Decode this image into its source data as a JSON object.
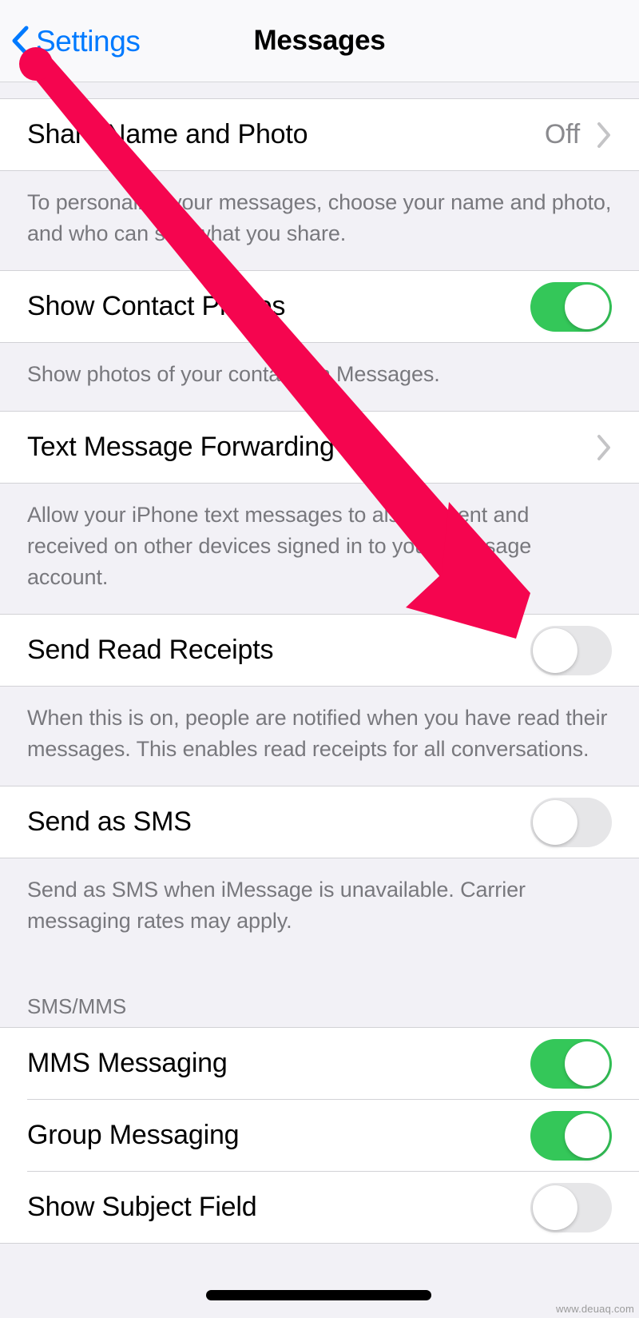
{
  "navbar": {
    "back_label": "Settings",
    "back_icon": "chevron-left-icon",
    "title": "Messages",
    "accent_color": "#007AFF"
  },
  "colors": {
    "toggle_on": "#34C759",
    "toggle_off": "#E6E6E8",
    "group_background": "#F2F1F6",
    "row_background": "#FFFFFF",
    "footnote_text": "#78787D",
    "annotation_arrow": "#F5054F"
  },
  "sections": [
    {
      "rows": [
        {
          "label": "Share Name and Photo",
          "type": "disclosure",
          "value": "Off",
          "accessory_icon": "chevron-right-icon"
        }
      ],
      "footnote": "To personalize your messages, choose your name and photo, and who can see what you share."
    },
    {
      "rows": [
        {
          "label": "Show Contact Photos",
          "type": "toggle",
          "state": "on"
        }
      ],
      "footnote": "Show photos of your contacts in Messages."
    },
    {
      "rows": [
        {
          "label": "Text Message Forwarding",
          "type": "disclosure",
          "value": "",
          "accessory_icon": "chevron-right-icon"
        }
      ],
      "footnote": "Allow your iPhone text messages to also be sent and received on other devices signed in to your iMessage account."
    },
    {
      "rows": [
        {
          "label": "Send Read Receipts",
          "type": "toggle",
          "state": "off"
        }
      ],
      "footnote": "When this is on, people are notified when you have read their messages. This enables read receipts for all conversations."
    },
    {
      "rows": [
        {
          "label": "Send as SMS",
          "type": "toggle",
          "state": "off"
        }
      ],
      "footnote": "Send as SMS when iMessage is unavailable. Carrier messaging rates may apply."
    },
    {
      "header": "SMS/MMS",
      "rows": [
        {
          "label": "MMS Messaging",
          "type": "toggle",
          "state": "on"
        },
        {
          "label": "Group Messaging",
          "type": "toggle",
          "state": "on"
        },
        {
          "label": "Show Subject Field",
          "type": "toggle",
          "state": "off"
        }
      ]
    }
  ],
  "annotation": {
    "type": "arrow",
    "description": "red arrow pointing to Send Read Receipts toggle"
  },
  "watermark": "www.deuaq.com"
}
